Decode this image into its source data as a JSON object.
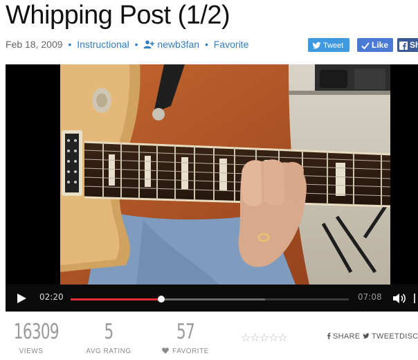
{
  "page": {
    "title": "Whipping Post (1/2)"
  },
  "meta": {
    "date": "Feb 18, 2009",
    "category": "Instructional",
    "username": "newb3fan",
    "favorite": "Favorite",
    "separator": "•"
  },
  "share_buttons": {
    "tweet": "Tweet",
    "like": "Like",
    "facebook": "Sh"
  },
  "player": {
    "current_time": "02:20",
    "duration": "07:08",
    "progress_fraction": 0.327,
    "buffered_fraction": 0.7,
    "accent_color": "#e22f36"
  },
  "stats": {
    "views": {
      "value": "16309",
      "label": "VIEWS"
    },
    "rating": {
      "value": "5",
      "label": "AVG RATING"
    },
    "favorites": {
      "value": "57",
      "label": "FAVORITE"
    },
    "stars": [
      "☆",
      "☆",
      "☆",
      "☆",
      "☆"
    ]
  },
  "share_links": {
    "share": "SHARE",
    "tweet": "TWEET",
    "discuss": "DISCU"
  },
  "icons": {
    "twitter": "twitter-bird-icon",
    "like": "checkmark-icon",
    "facebook": "facebook-icon",
    "add_user": "add-user-icon",
    "play": "play-icon",
    "volume": "volume-icon",
    "heart": "heart-icon"
  }
}
